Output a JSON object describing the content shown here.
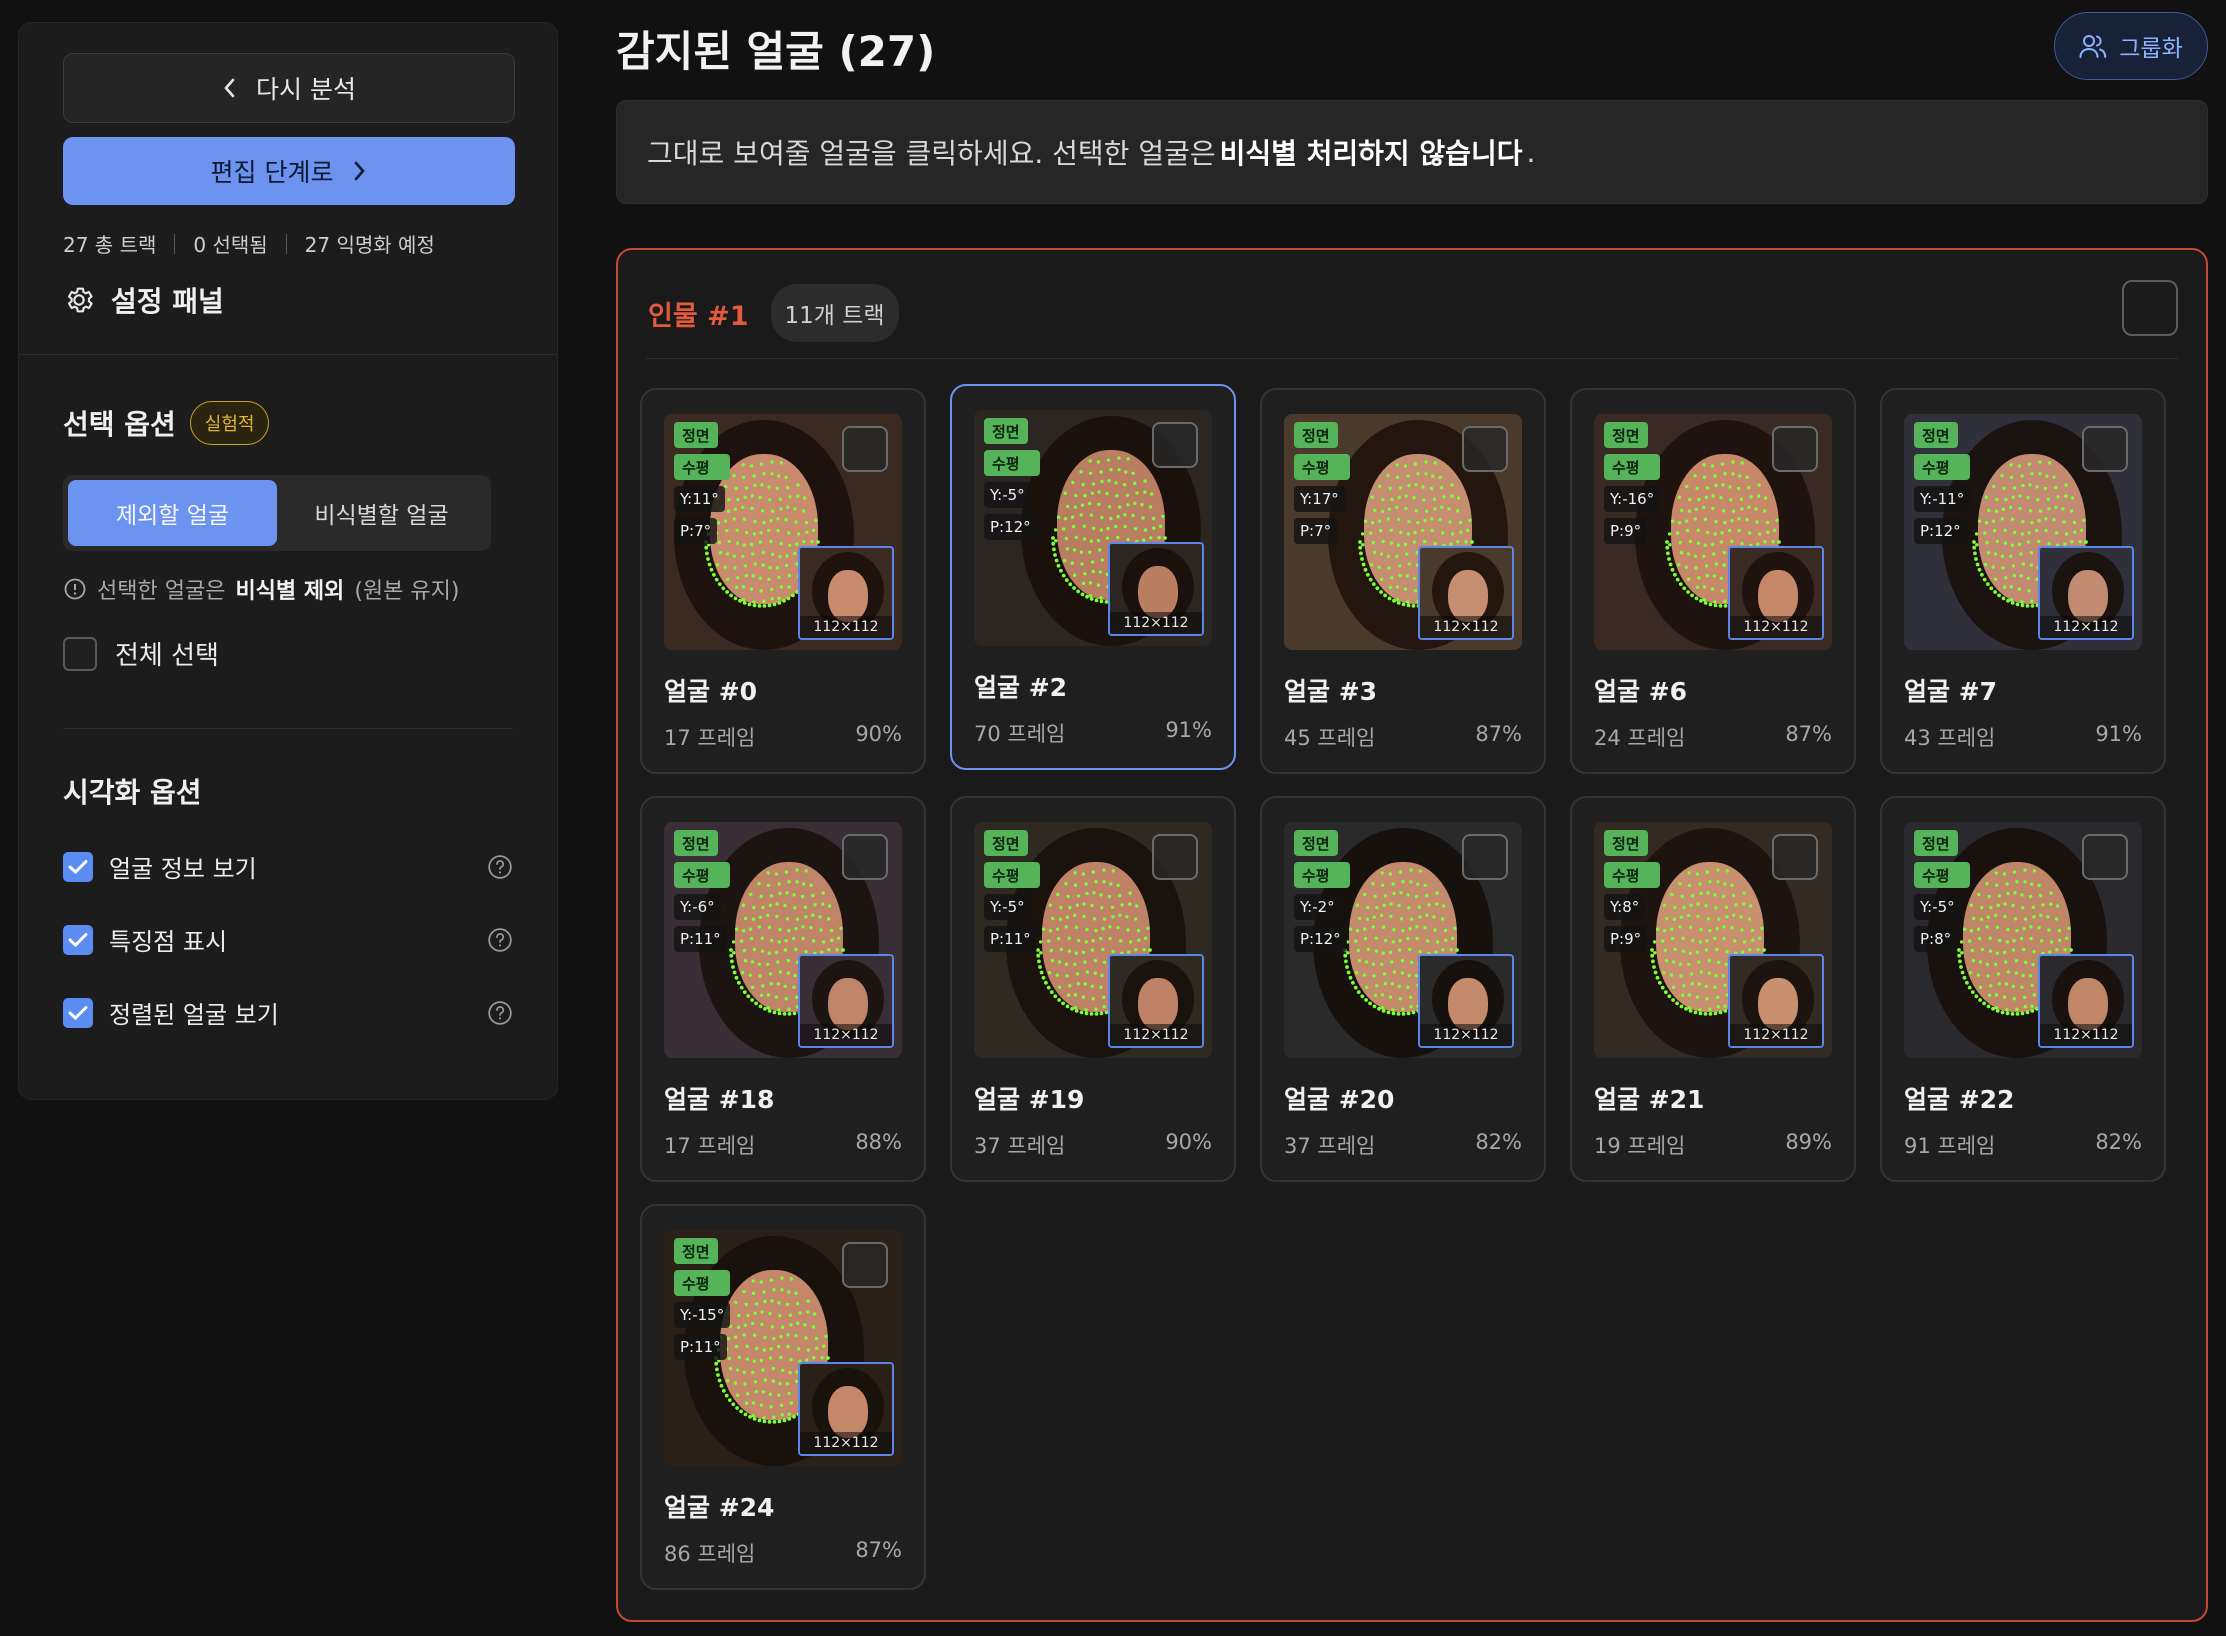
{
  "sidebar": {
    "back_label": "다시 분석",
    "next_label": "편집 단계로",
    "stats": [
      "27 총 트랙",
      "0 선택됨",
      "27 익명화 예정"
    ],
    "settings_title": "설정 패널",
    "selection_title": "선택 옵션",
    "selection_badge": "실험적",
    "segment": [
      "제외할 얼굴",
      "비식별할 얼굴"
    ],
    "hint_prefix": "선택한 얼굴은",
    "hint_bold": "비식별 제외",
    "hint_suffix": "(원본 유지)",
    "select_all": "전체 선택",
    "vis_title": "시각화 옵션",
    "vis_options": [
      "얼굴 정보 보기",
      "특징점 표시",
      "정렬된 얼굴 보기"
    ]
  },
  "main": {
    "title": "감지된 얼굴 (27)",
    "group_label": "그룹화",
    "info_prefix": "그대로 보여줄 얼굴을 클릭하세요. 선택한 얼굴은",
    "info_bold": "비식별 처리하지 않습니다",
    "info_suffix": ".",
    "person_title": "인물 #1",
    "person_tracks": "11개 트랙",
    "tag_front": "정면",
    "tag_level": "수평",
    "inset_size": "112×112",
    "cards": [
      {
        "title": "얼굴 #0",
        "frames": "17 프레임",
        "conf": "90%",
        "yaw": "Y:11°",
        "pitch": "P:7°"
      },
      {
        "title": "얼굴 #2",
        "frames": "70 프레임",
        "conf": "91%",
        "yaw": "Y:-5°",
        "pitch": "P:12°"
      },
      {
        "title": "얼굴 #3",
        "frames": "45 프레임",
        "conf": "87%",
        "yaw": "Y:17°",
        "pitch": "P:7°"
      },
      {
        "title": "얼굴 #6",
        "frames": "24 프레임",
        "conf": "87%",
        "yaw": "Y:-16°",
        "pitch": "P:9°"
      },
      {
        "title": "얼굴 #7",
        "frames": "43 프레임",
        "conf": "91%",
        "yaw": "Y:-11°",
        "pitch": "P:12°"
      },
      {
        "title": "얼굴 #18",
        "frames": "17 프레임",
        "conf": "88%",
        "yaw": "Y:-6°",
        "pitch": "P:11°"
      },
      {
        "title": "얼굴 #19",
        "frames": "37 프레임",
        "conf": "90%",
        "yaw": "Y:-5°",
        "pitch": "P:11°"
      },
      {
        "title": "얼굴 #20",
        "frames": "37 프레임",
        "conf": "82%",
        "yaw": "Y:-2°",
        "pitch": "P:12°"
      },
      {
        "title": "얼굴 #21",
        "frames": "19 프레임",
        "conf": "89%",
        "yaw": "Y:8°",
        "pitch": "P:9°"
      },
      {
        "title": "얼굴 #22",
        "frames": "91 프레임",
        "conf": "82%",
        "yaw": "Y:-5°",
        "pitch": "P:8°"
      },
      {
        "title": "얼굴 #24",
        "frames": "86 프레임",
        "conf": "87%",
        "yaw": "Y:-15°",
        "pitch": "P:11°"
      }
    ]
  },
  "colors": {
    "accent": "#6b93ef",
    "person_border": "#c24a32",
    "tag_green": "#55b45a",
    "landmark": "#7cff3a"
  }
}
